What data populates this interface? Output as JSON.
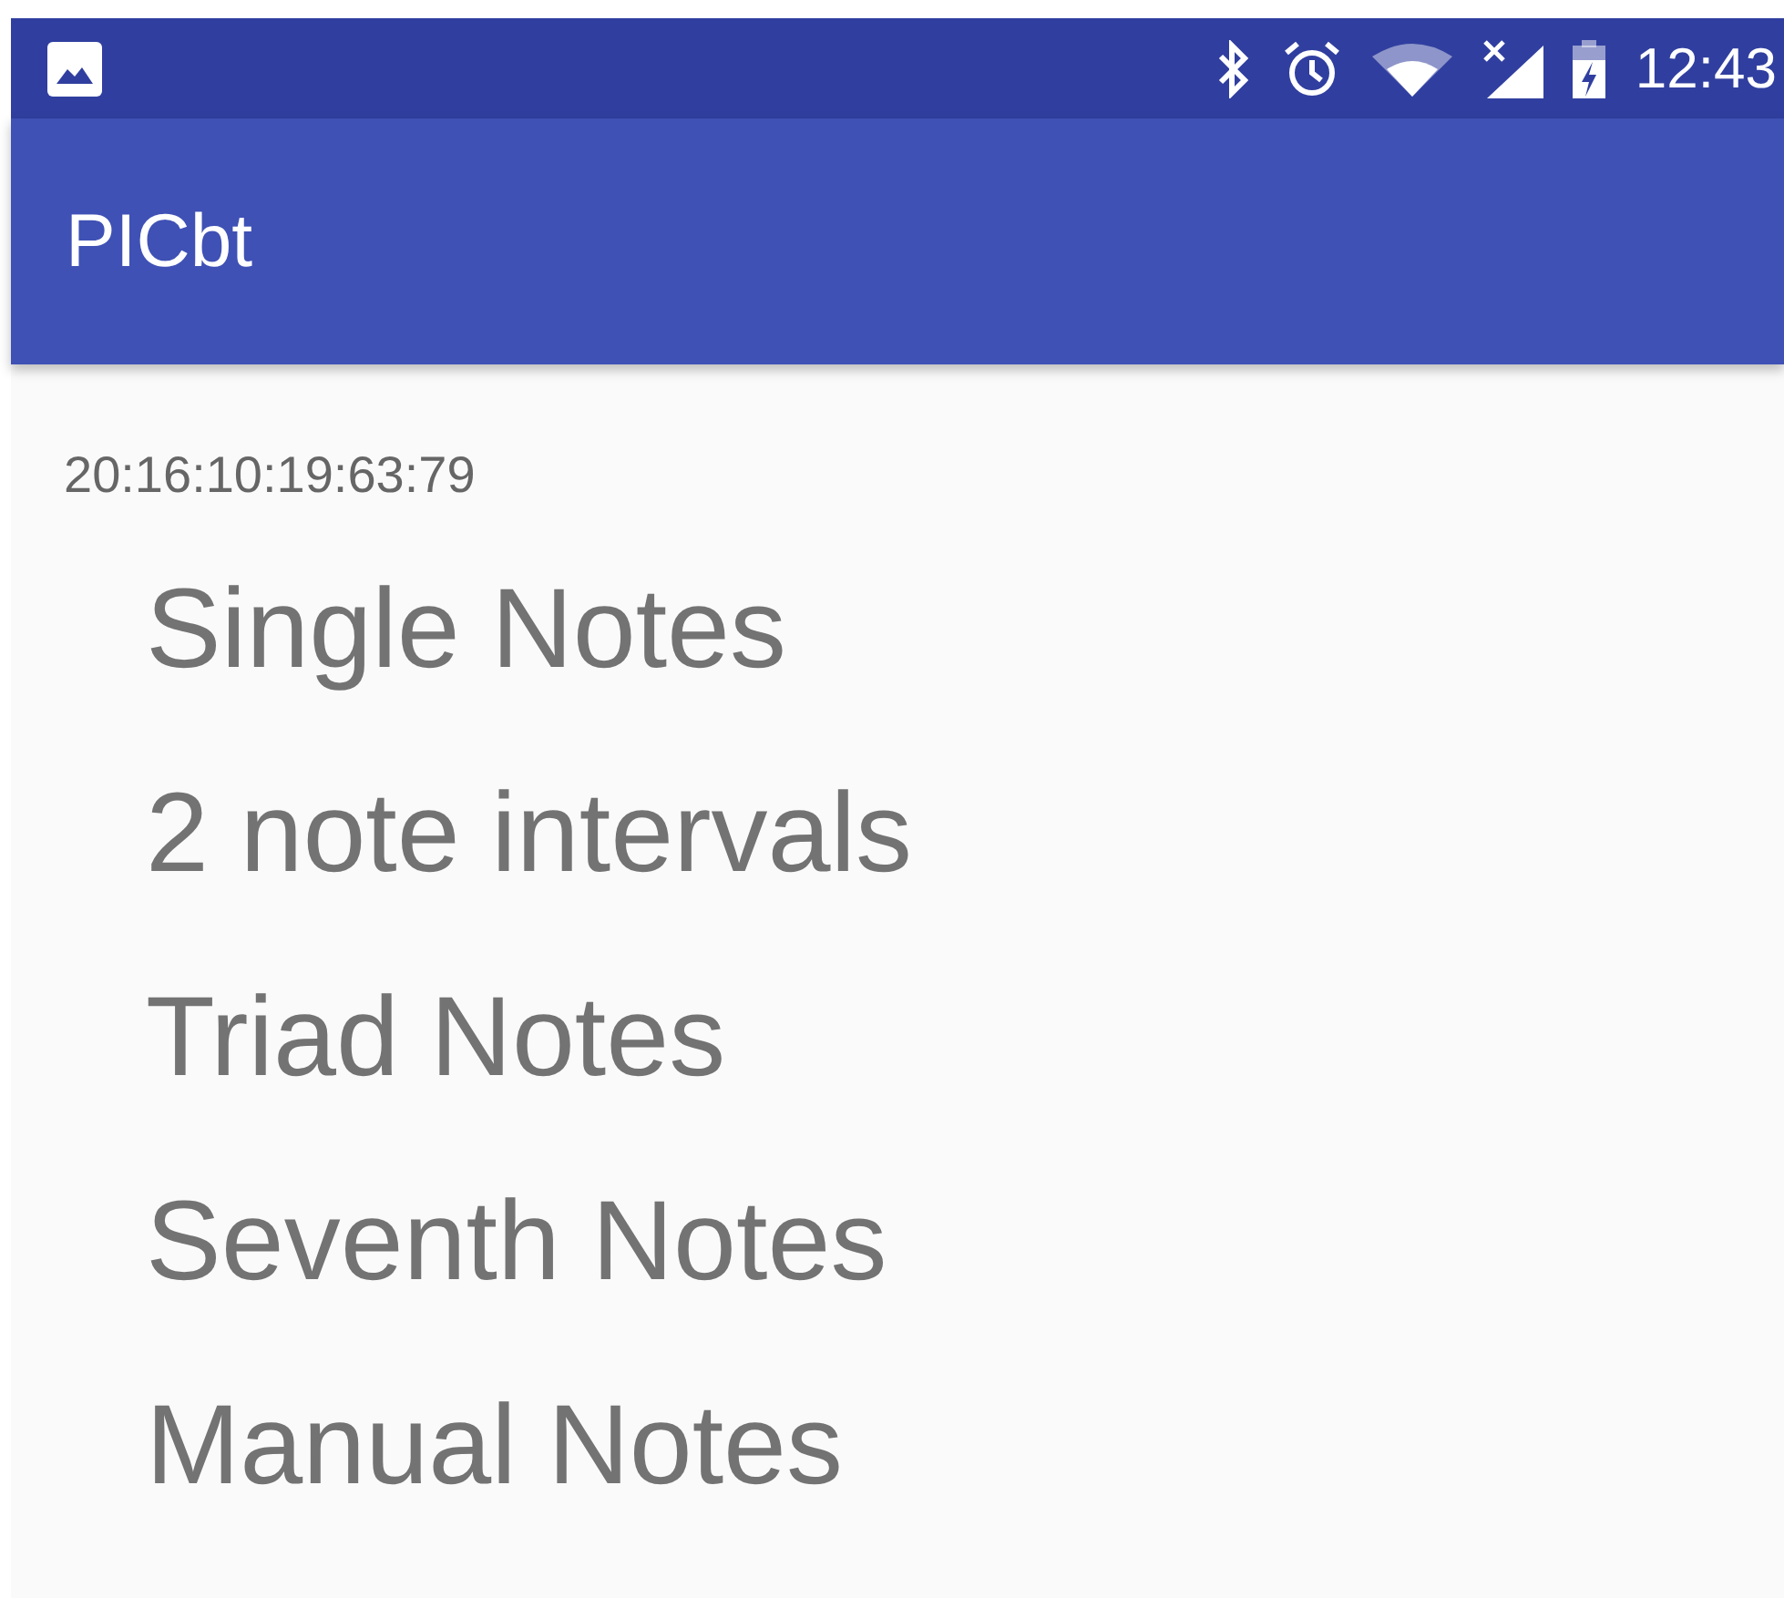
{
  "status_bar": {
    "time": "12:43"
  },
  "app_bar": {
    "title": "PICbt"
  },
  "device_address": "20:16:10:19:63:79",
  "menu_items": [
    {
      "label": "Single Notes"
    },
    {
      "label": "2 note intervals"
    },
    {
      "label": "Triad Notes"
    },
    {
      "label": "Seventh Notes"
    },
    {
      "label": "Manual Notes"
    }
  ]
}
